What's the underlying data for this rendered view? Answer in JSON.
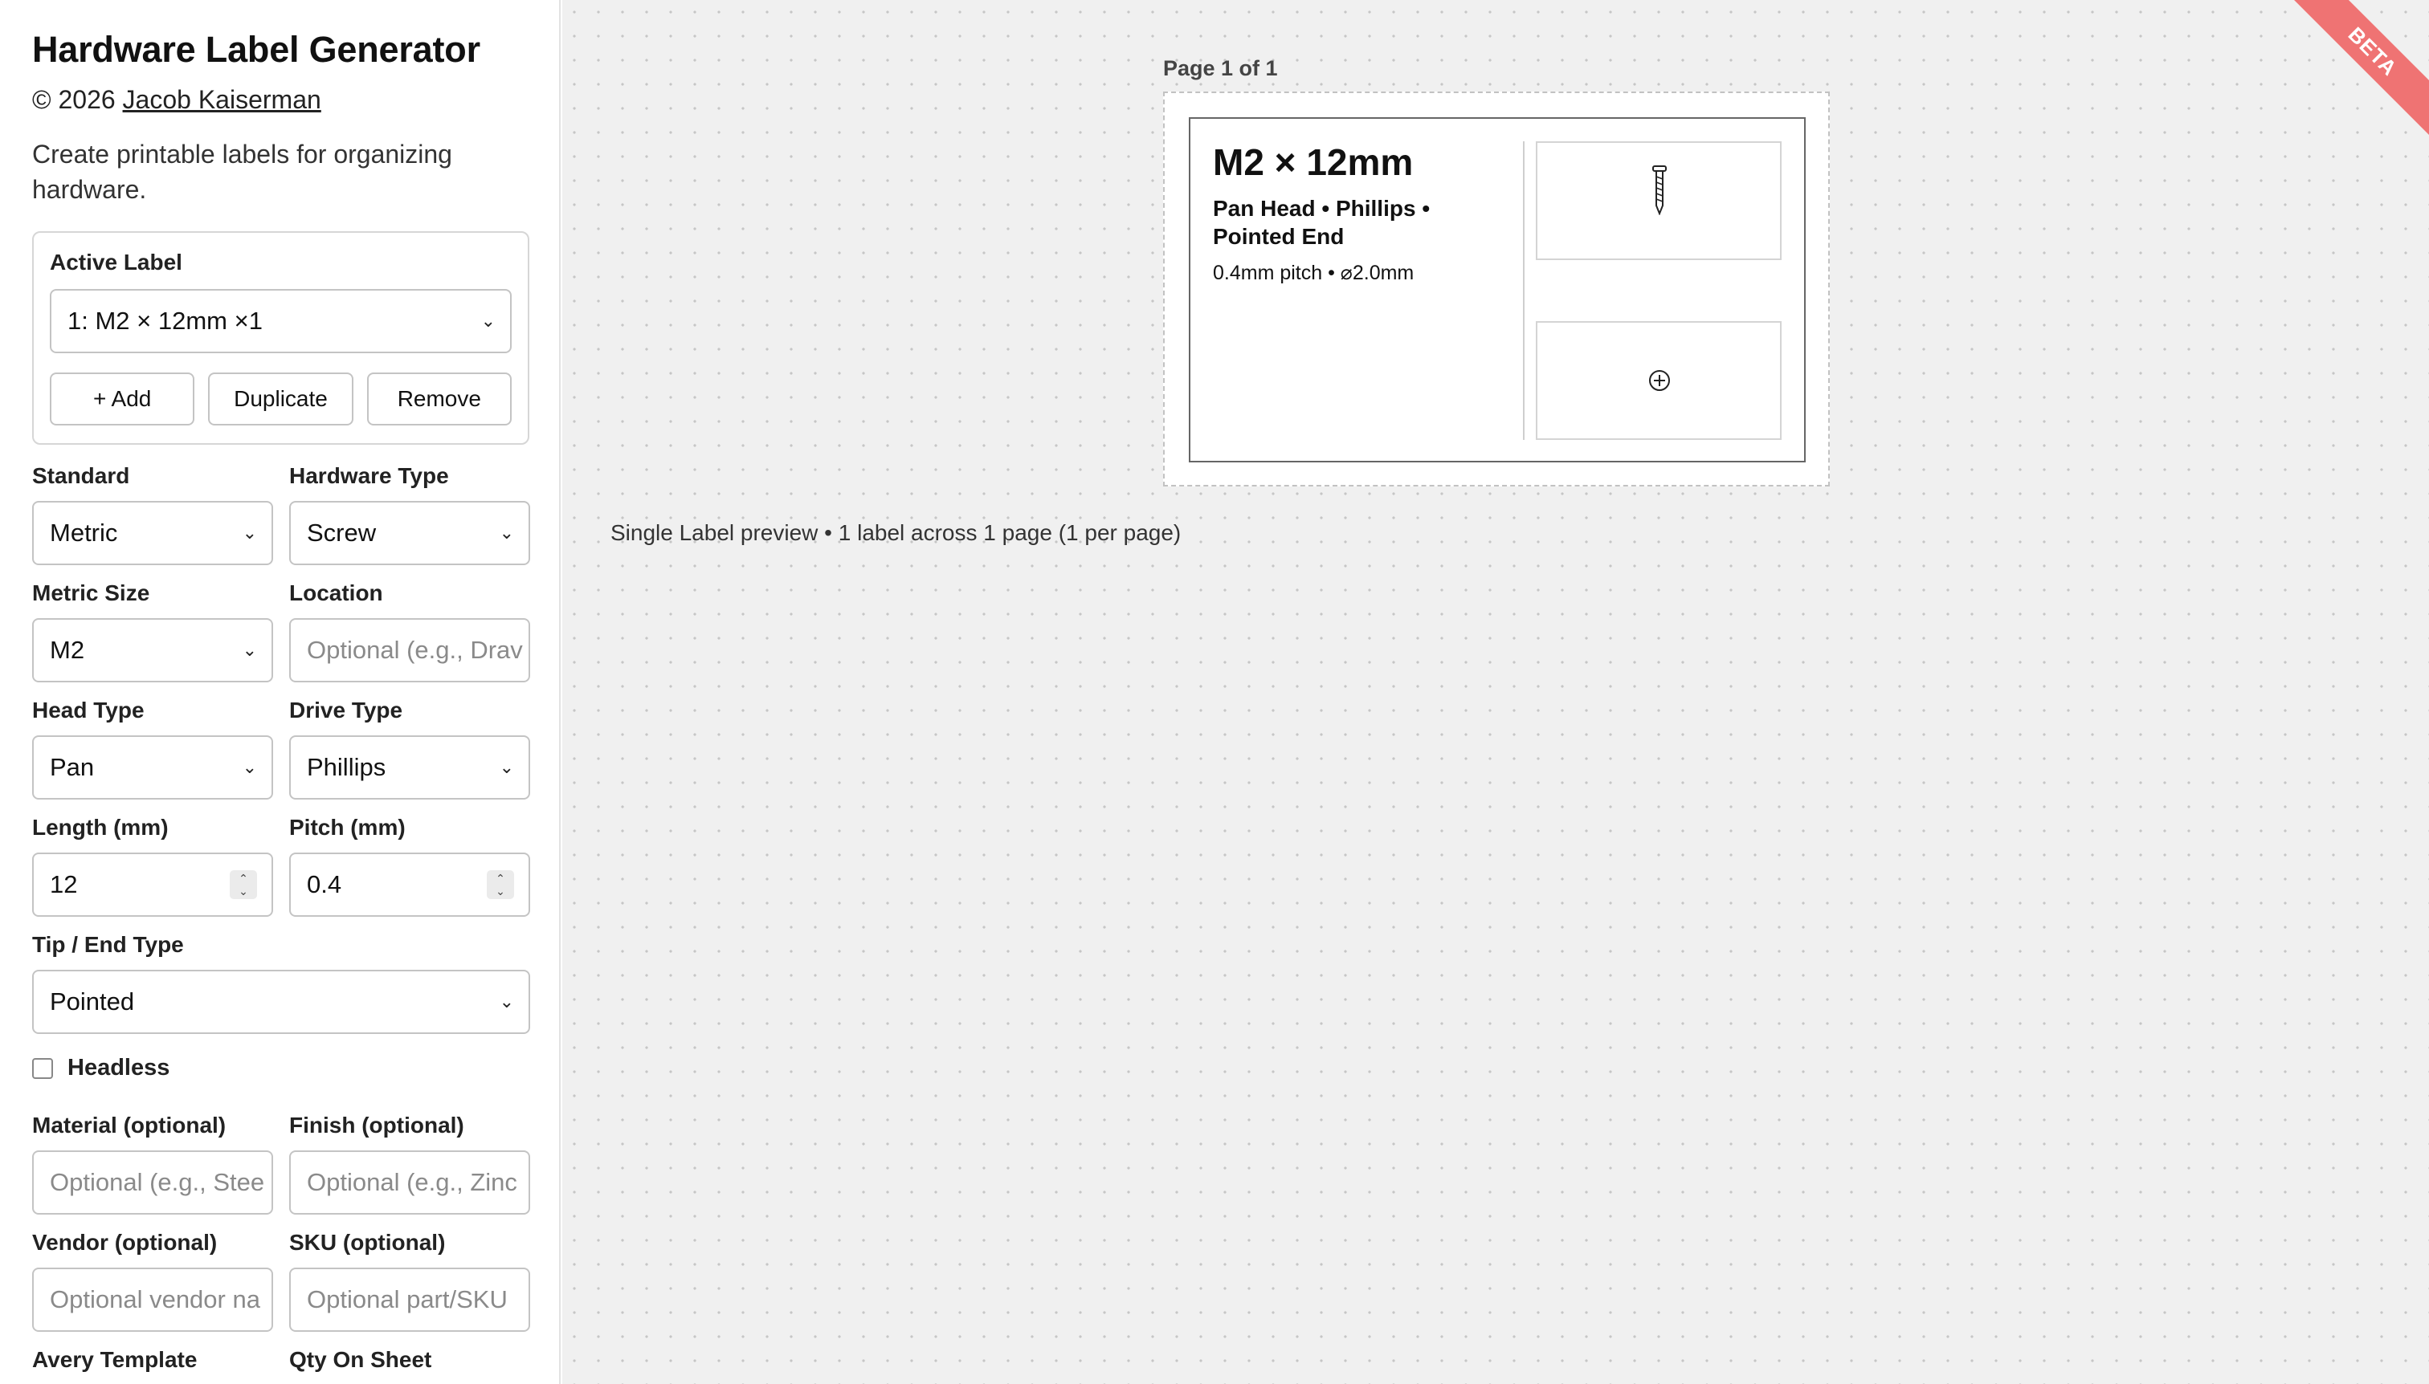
{
  "app": {
    "title": "Hardware Label Generator",
    "copyright_prefix": "© 2026",
    "author": "Jacob Kaiserman",
    "description": "Create printable labels for organizing hardware."
  },
  "active_label": {
    "heading": "Active Label",
    "selected": "1: M2 × 12mm ×1",
    "add_label": "+ Add",
    "duplicate_label": "Duplicate",
    "remove_label": "Remove"
  },
  "form": {
    "standard": {
      "label": "Standard",
      "value": "Metric"
    },
    "hardware_type": {
      "label": "Hardware Type",
      "value": "Screw"
    },
    "metric_size": {
      "label": "Metric Size",
      "value": "M2"
    },
    "location": {
      "label": "Location",
      "placeholder": "Optional (e.g., Drav"
    },
    "head_type": {
      "label": "Head Type",
      "value": "Pan"
    },
    "drive_type": {
      "label": "Drive Type",
      "value": "Phillips"
    },
    "length": {
      "label": "Length (mm)",
      "value": "12"
    },
    "pitch": {
      "label": "Pitch (mm)",
      "value": "0.4"
    },
    "tip_type": {
      "label": "Tip / End Type",
      "value": "Pointed"
    },
    "headless": {
      "label": "Headless",
      "checked": false
    },
    "material": {
      "label": "Material (optional)",
      "placeholder": "Optional (e.g., Stee"
    },
    "finish": {
      "label": "Finish (optional)",
      "placeholder": "Optional (e.g., Zinc"
    },
    "vendor": {
      "label": "Vendor (optional)",
      "placeholder": "Optional vendor na"
    },
    "sku": {
      "label": "SKU (optional)",
      "placeholder": "Optional part/SKU"
    },
    "avery_template": {
      "label": "Avery Template"
    },
    "qty_on_sheet": {
      "label": "Qty On Sheet"
    }
  },
  "preview": {
    "page_label": "Page 1 of 1",
    "label_title": "M2 × 12mm",
    "label_subtitle": "Pan Head • Phillips • Pointed End",
    "label_spec": "0.4mm pitch • ⌀2.0mm",
    "caption": "Single Label preview • 1 label across 1 page (1 per page)"
  },
  "icons": {
    "chevron": "chevron-down-icon",
    "screw": "screw-icon",
    "phillips_drive": "phillips-drive-icon"
  },
  "badge": {
    "text": "BETA",
    "color": "#ef7373"
  }
}
